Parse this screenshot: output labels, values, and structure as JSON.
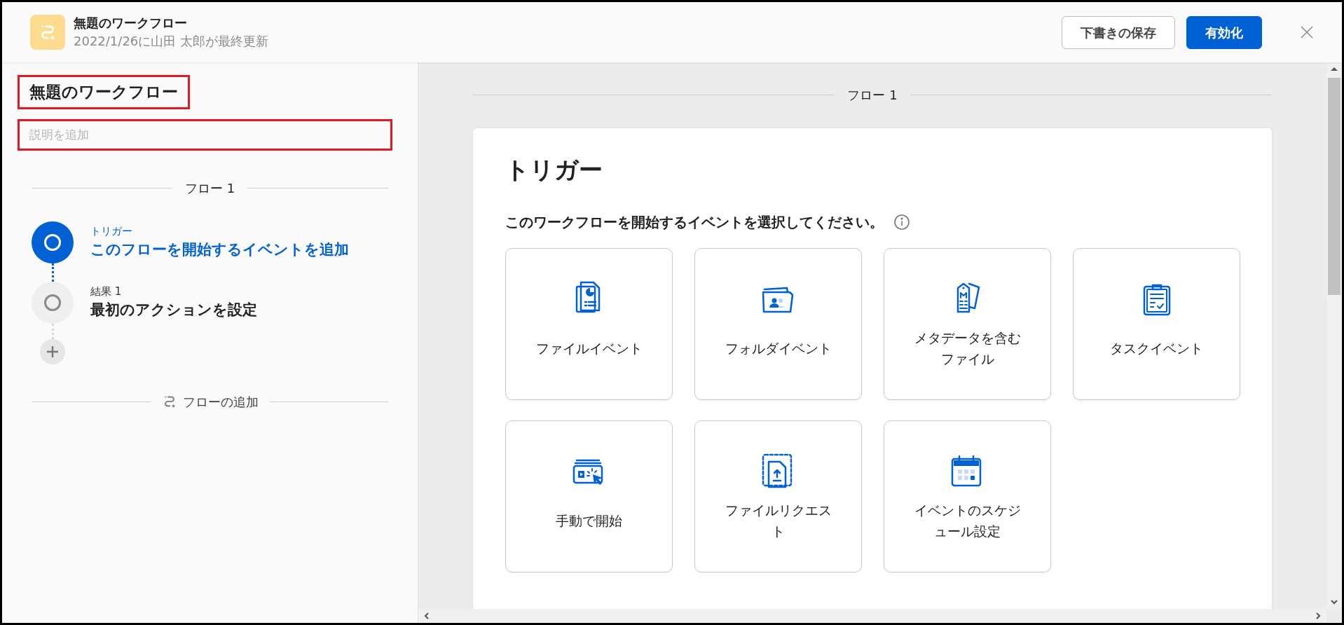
{
  "header": {
    "title": "無題のワークフロー",
    "subtitle": "2022/1/26に山田 太郎が最終更新",
    "buttons": [
      {
        "label": "下書きの保存",
        "kind": "secondary"
      },
      {
        "label": "有効化",
        "kind": "primary"
      }
    ]
  },
  "sidebar": {
    "title": "無題のワークフロー",
    "description": {
      "placeholder": "説明を追加"
    },
    "flow_label": "フロー 1",
    "steps": [
      {
        "label": "トリガー",
        "title": "このフローを開始するイベントを追加",
        "selected": true
      },
      {
        "label": "結果 1",
        "title": "最初のアクションを設定",
        "selected": false
      }
    ],
    "add_flow": "フローの追加"
  },
  "main": {
    "flow_label": "フロー 1",
    "panel_title": "トリガー",
    "prompt": "このワークフローを開始するイベントを選択してください。",
    "options": [
      {
        "label": "ファイルイベント",
        "kind": "file"
      },
      {
        "label": "フォルダイベント",
        "kind": "folder"
      },
      {
        "label": "メタデータを含むファイル",
        "kind": "metadata"
      },
      {
        "label": "タスクイベント",
        "kind": "task"
      },
      {
        "label": "手動で開始",
        "kind": "manual"
      },
      {
        "label": "ファイルリクエスト",
        "kind": "request"
      },
      {
        "label": "イベントのスケジュール設定",
        "kind": "schedule"
      }
    ]
  }
}
